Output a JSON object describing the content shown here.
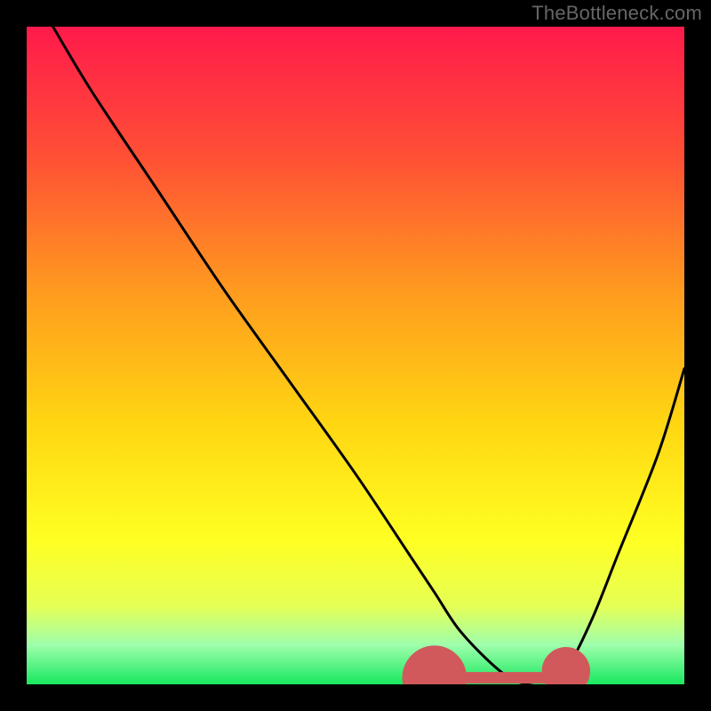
{
  "watermark": "TheBottleneck.com",
  "chart_data": {
    "type": "line",
    "title": "",
    "xlabel": "",
    "ylabel": "",
    "xlim": [
      0,
      100
    ],
    "ylim": [
      0,
      100
    ],
    "grid": false,
    "legend": false,
    "gradient_stops": [
      {
        "offset": 0,
        "color": "#ff1a4b"
      },
      {
        "offset": 20,
        "color": "#ff5035"
      },
      {
        "offset": 40,
        "color": "#ff9a1f"
      },
      {
        "offset": 60,
        "color": "#ffd512"
      },
      {
        "offset": 78,
        "color": "#ffff22"
      },
      {
        "offset": 88,
        "color": "#e6ff55"
      },
      {
        "offset": 94,
        "color": "#9fffac"
      },
      {
        "offset": 100,
        "color": "#18e860"
      }
    ],
    "series": [
      {
        "name": "bottleneck-curve",
        "color": "#000000",
        "x": [
          4,
          10,
          20,
          30,
          40,
          50,
          58,
          62,
          66,
          72,
          76,
          80,
          82,
          86,
          90,
          96,
          100
        ],
        "y": [
          100,
          90,
          75,
          60,
          46,
          32,
          20,
          14,
          8,
          2,
          0,
          0,
          2,
          10,
          20,
          35,
          48
        ]
      }
    ],
    "highlight_band": {
      "name": "optimal-range",
      "color": "#d1595c",
      "x_start": 62,
      "x_end": 82,
      "y": 1,
      "endpoint_radius": 1.4
    }
  }
}
